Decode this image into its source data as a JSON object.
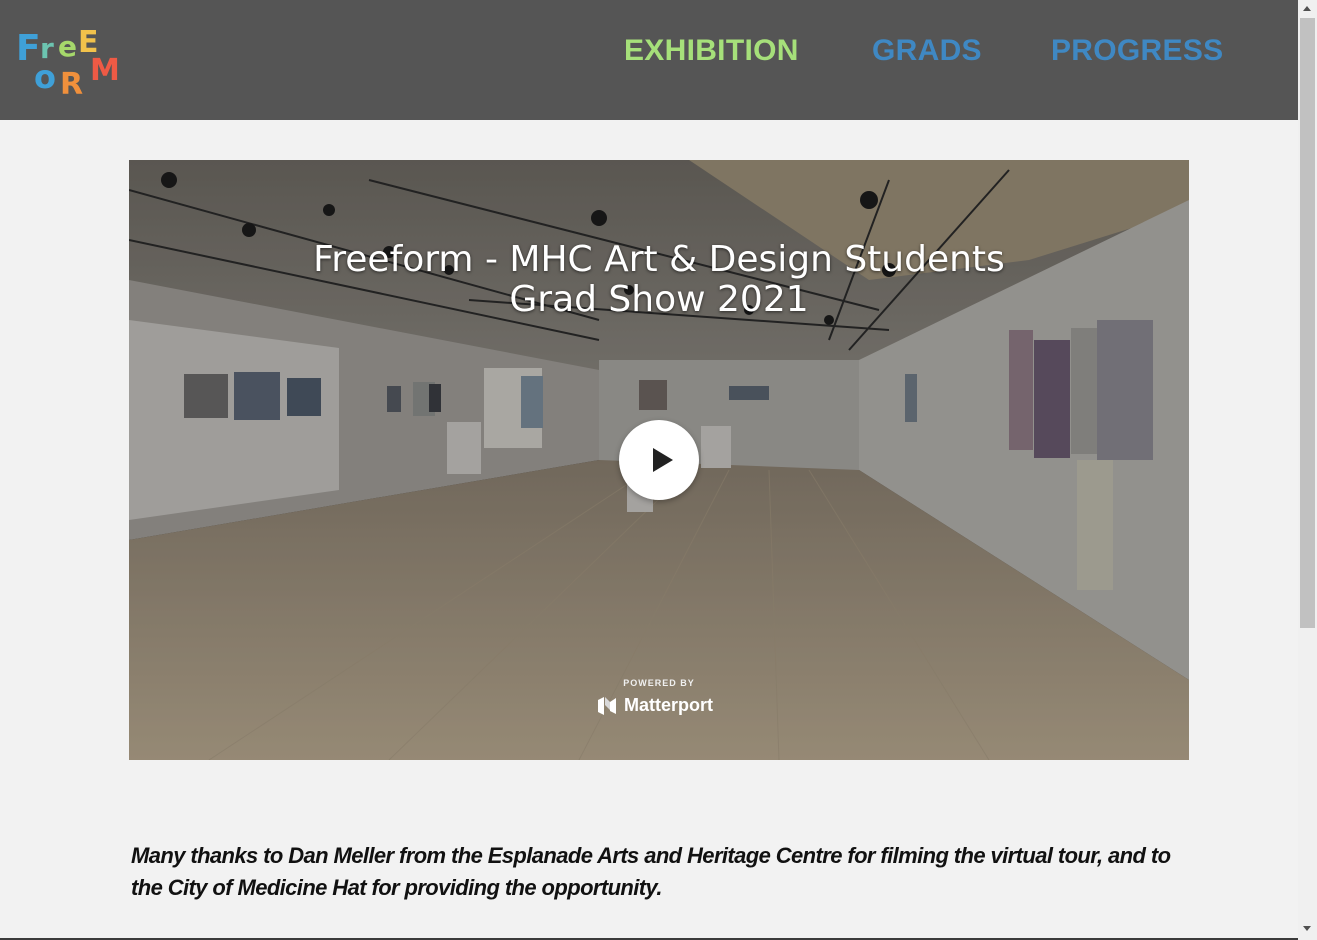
{
  "brand": {
    "logo_text": "FREEFORM",
    "logo_colors": [
      "#3fa0d8",
      "#a6d86b",
      "#f2c24b",
      "#ee5a45",
      "#9b6ad0"
    ]
  },
  "nav": {
    "items": [
      {
        "label": "EXHIBITION",
        "color": "#a6e07a",
        "active": true
      },
      {
        "label": "GRADS",
        "color": "#3f88c3"
      },
      {
        "label": "PROGRESS",
        "color": "#3f88c3"
      }
    ]
  },
  "tour": {
    "title": "Freeform - MHC Art & Design Students Grad Show 2021",
    "powered_by": "POWERED BY",
    "provider": "Matterport",
    "play_icon": "play-icon"
  },
  "caption": "Many thanks to Dan Meller from the Esplanade Arts and Heritage Centre for filming the virtual tour, and to the City of Medicine Hat for providing the opportunity.",
  "colors": {
    "header_bg": "#555555",
    "page_bg": "#f2f2f2"
  }
}
